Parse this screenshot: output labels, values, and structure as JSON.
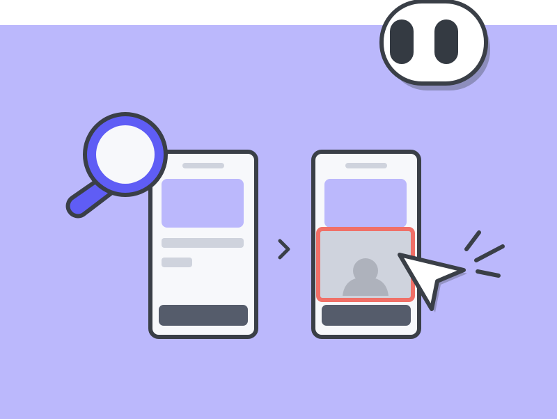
{
  "scene": {
    "description_hidden": "",
    "colors": {
      "background": "#bbb8fc",
      "outline": "#3a3f47",
      "screen": "#f7f8fb",
      "hero_block": "#bbb8fc",
      "text_line": "#cfd3dd",
      "primary_button": "#555c6b",
      "highlight_border": "#f07068",
      "image_tile": "#cfd3dd",
      "avatar": "#aeb2bc",
      "magnifier": "#5f5df5",
      "eyes_white": "#ffffff",
      "pupil": "#343a42"
    },
    "icons": {
      "magnifier": "magnifier-icon",
      "arrow": "chevron-right-icon",
      "cursor": "pointer-cursor-icon",
      "avatar": "user-avatar-icon",
      "eyes": "googly-eyes-icon",
      "spark": "click-spark-icon"
    }
  }
}
